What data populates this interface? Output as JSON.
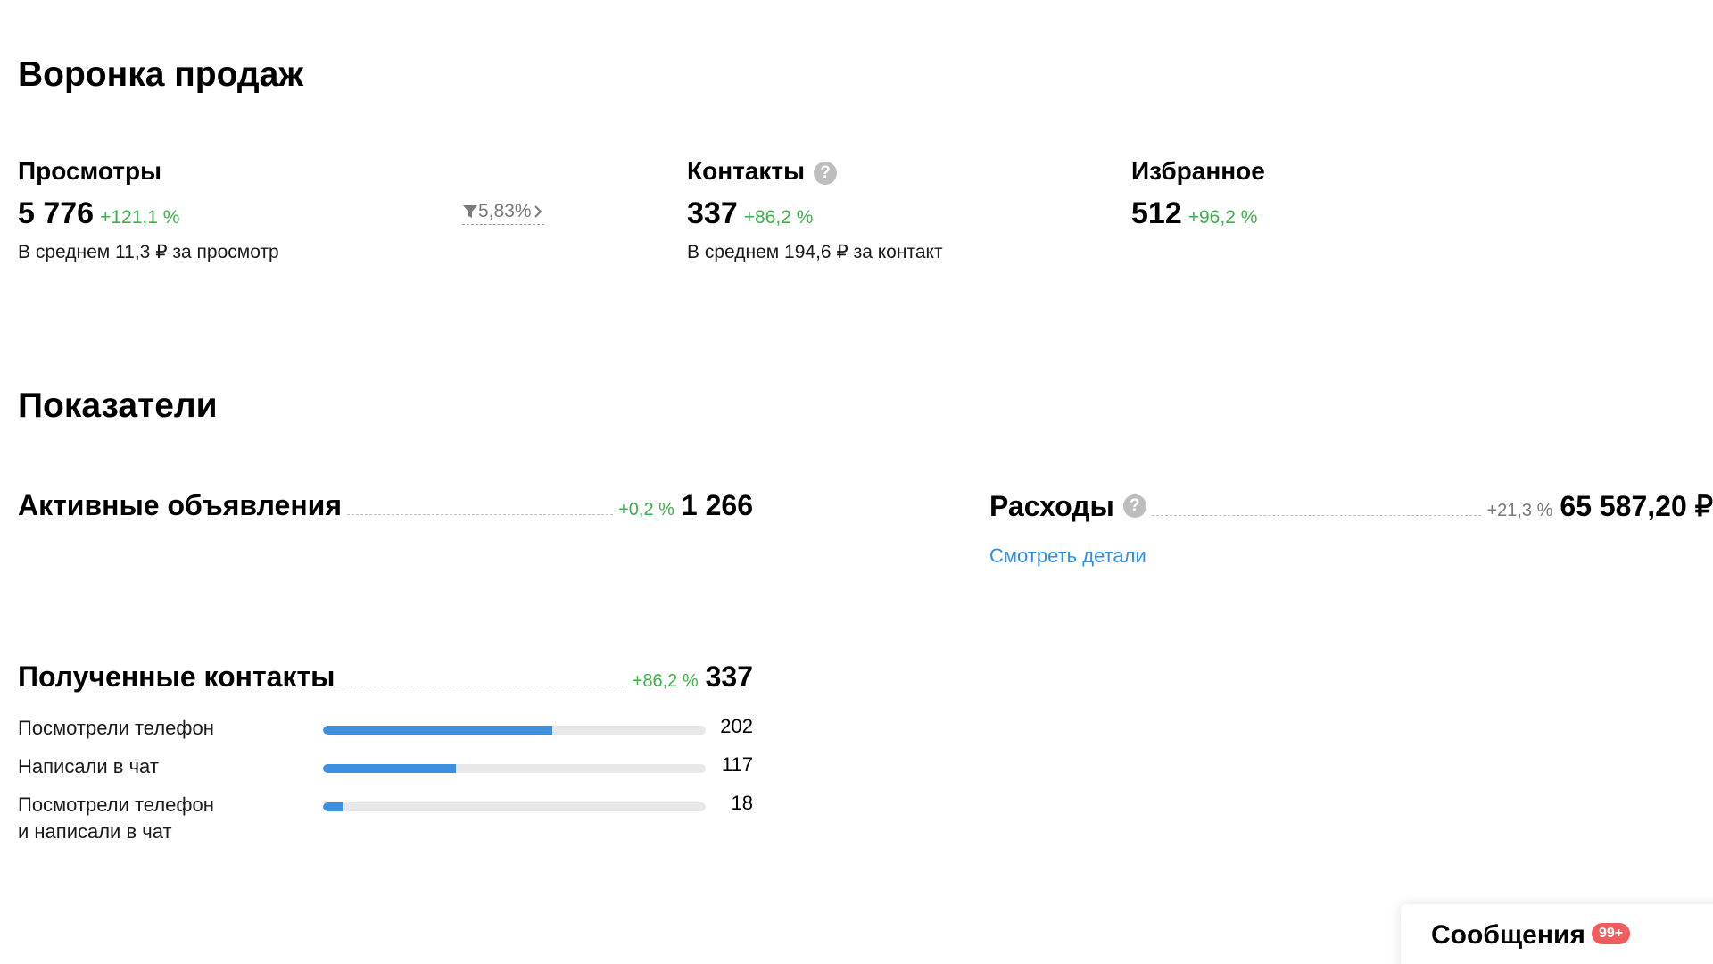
{
  "funnel": {
    "title": "Воронка продаж",
    "views": {
      "label": "Просмотры",
      "value": "5 776",
      "delta": "+121,1 %",
      "sub": "В среднем 11,3 ₽ за просмотр",
      "conversion": "5,83%"
    },
    "contacts": {
      "label": "Контакты",
      "value": "337",
      "delta": "+86,2 %",
      "sub": "В среднем 194,6 ₽ за контакт"
    },
    "favorites": {
      "label": "Избранное",
      "value": "512",
      "delta": "+96,2 %"
    }
  },
  "indicators": {
    "title": "Показатели",
    "active_ads": {
      "label": "Активные объявления",
      "delta": "+0,2 %",
      "value": "1 266"
    },
    "expenses": {
      "label": "Расходы",
      "delta": "+21,3 %",
      "value": "65 587,20 ₽",
      "details_link": "Смотреть детали"
    },
    "received_contacts": {
      "label": "Полученные контакты",
      "delta": "+86,2 %",
      "value": "337",
      "bars": [
        {
          "label": "Посмотрели телефон",
          "count": "202",
          "fraction": 0.599
        },
        {
          "label": "Написали в чат",
          "count": "117",
          "fraction": 0.347
        },
        {
          "label": "Посмотрели телефон\nи написали в чат",
          "count": "18",
          "fraction": 0.053
        }
      ]
    }
  },
  "messages": {
    "label": "Сообщения",
    "badge": "99+"
  },
  "colors": {
    "positive": "#3fae4d",
    "bar_fill": "#3d8fe0",
    "bar_track": "#e8e8e8",
    "link": "#2f8fe6",
    "badge": "#f05d5e"
  }
}
